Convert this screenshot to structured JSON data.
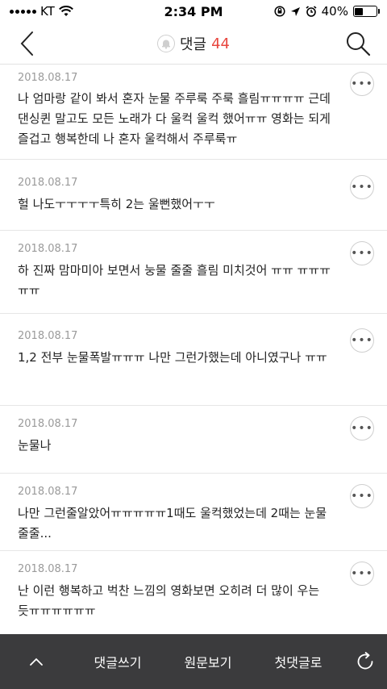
{
  "status_bar": {
    "carrier": "KT",
    "time": "2:34 PM",
    "battery": "40%",
    "battery_level": 0.4
  },
  "header": {
    "title": "댓글",
    "count": "44"
  },
  "comments": [
    {
      "date": "2018.08.17",
      "text": "나 엄마랑 같이 봐서 혼자 눈물 주루룩 주룩 흘림ㅠㅠㅠㅠ 근데 댄싱퀸 말고도 모든 노래가 다 울컥 울컥 했어ㅠㅠ 영화는 되게 즐겁고 행복한데 나 혼자 울컥해서 주루룩ㅠ",
      "more": "•••"
    },
    {
      "date": "2018.08.17",
      "text": "헐 나도ㅜㅜㅜㅜ특히 2는 울뻔했어ㅜㅜ",
      "more": "•••"
    },
    {
      "date": "2018.08.17",
      "text": "하 진짜 맘마미아 보면서 눙물 줄줄 흘림 미치것어 ㅠㅠ ㅠㅠㅠㅠㅠ",
      "more": "•••"
    },
    {
      "date": "2018.08.17",
      "text": "1,2  전부 눈물폭발ㅠㅠㅠ 나만 그런가했는데 아니였구나 ㅠㅠ",
      "more": "•••"
    },
    {
      "date": "2018.08.17",
      "text": "눈물나",
      "more": "•••"
    },
    {
      "date": "2018.08.17",
      "text": "나만 그런줄알았어ㅠㅠㅠㅠㅠ1때도 울컥했었는데 2때는 눈물줄줄...",
      "more": "•••"
    },
    {
      "date": "2018.08.17",
      "text": "난 이런 행복하고 벅찬 느낌의 영화보면 오히려 더 많이 우는 듯ㅠㅠㅠㅠㅠㅠ",
      "more": "•••"
    }
  ],
  "bottom_bar": {
    "write_comment": "댓글쓰기",
    "view_original": "원문보기",
    "first_comment": "첫댓글로"
  },
  "colors": {
    "accent": "#e8473f",
    "bottom_bar_bg": "#3b3b3d",
    "date_text": "#9a9a9a"
  },
  "icons": {
    "back": "chevron-left-icon",
    "bell": "bell-icon",
    "search": "search-icon",
    "scroll_top": "chevron-up-icon",
    "refresh": "refresh-icon",
    "more": "more-dots-icon"
  }
}
